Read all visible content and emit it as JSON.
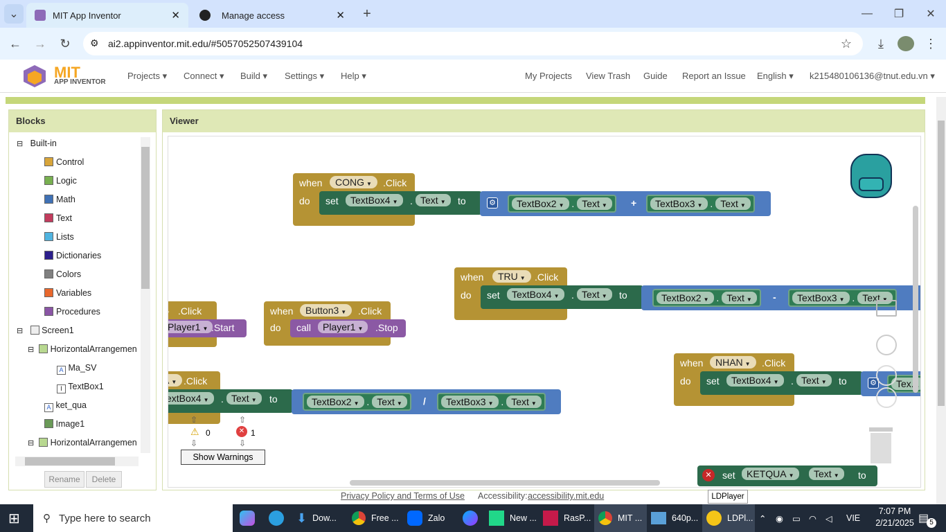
{
  "browser": {
    "tabs": [
      {
        "title": "MIT App Inventor",
        "active": true
      },
      {
        "title": "Manage access",
        "active": false
      }
    ],
    "url": "ai2.appinventor.mit.edu/#5057052507439104"
  },
  "app": {
    "logo_main": "MIT",
    "logo_sub": "APP INVENTOR",
    "menu": [
      "Projects ▾",
      "Connect ▾",
      "Build ▾",
      "Settings ▾",
      "Help ▾"
    ],
    "right_menu": [
      "My Projects",
      "View Trash",
      "Guide",
      "Report an Issue",
      "English ▾",
      "k215480106136@tnut.edu.vn ▾"
    ]
  },
  "blocks_panel": {
    "title": "Blocks",
    "builtin_label": "Built-in",
    "builtin": [
      {
        "label": "Control",
        "color": "#d8a53a"
      },
      {
        "label": "Logic",
        "color": "#78b050"
      },
      {
        "label": "Math",
        "color": "#3f71b5"
      },
      {
        "label": "Text",
        "color": "#c23c5d"
      },
      {
        "label": "Lists",
        "color": "#50b4e0"
      },
      {
        "label": "Dictionaries",
        "color": "#2c1f8c"
      },
      {
        "label": "Colors",
        "color": "#808080"
      },
      {
        "label": "Variables",
        "color": "#e8682d"
      },
      {
        "label": "Procedures",
        "color": "#8a55a5"
      }
    ],
    "screen_label": "Screen1",
    "components": [
      "HorizontalArrangemen",
      "Ma_SV",
      "TextBox1",
      "ket_qua",
      "Image1",
      "HorizontalArrangemen"
    ],
    "rename": "Rename",
    "delete": "Delete"
  },
  "viewer": {
    "title": "Viewer",
    "warnings_count": "0",
    "errors_count": "1",
    "show_warnings": "Show Warnings",
    "kw": {
      "when": "when",
      "do": "do",
      "set": "set",
      "to": "to",
      "click": ".Click",
      "call": "call",
      "stop": ".Stop",
      "start": ".Start",
      "text": "Text",
      "dot": "."
    },
    "cong": {
      "comp": "CONG",
      "target": "TextBox4",
      "a": "TextBox2",
      "b": "TextBox3",
      "op": "+"
    },
    "tru": {
      "comp": "TRU",
      "target": "TextBox4",
      "a": "TextBox2",
      "b": "TextBox3",
      "op": "-"
    },
    "button3": {
      "comp": "Button3",
      "player": "Player1"
    },
    "partial_player": "Player1",
    "div": {
      "target": "TextBox4",
      "a": "TextBox2",
      "b": "TextBox3",
      "op": "/",
      "target_partial": "extBox4",
      "comp_partial": "A"
    },
    "nhan": {
      "comp": "NHAN",
      "target": "TextBox4",
      "partial": "Tex..."
    },
    "ketqua": {
      "comp": "KETQUA"
    },
    "tooltip": "LDPlayer"
  },
  "footer": {
    "privacy": "Privacy Policy and Terms of Use",
    "access_label": "Accessibility:",
    "access_link": "accessibility.mit.edu"
  },
  "taskbar": {
    "search": "Type here to search",
    "apps": [
      "Dow...",
      "Free ...",
      "Zalo",
      "New ...",
      "RasP...",
      "MIT ...",
      "640p...",
      "LDPl..."
    ],
    "lang": "VIE",
    "time": "7:07 PM",
    "date": "2/21/2025",
    "notif": "5"
  }
}
